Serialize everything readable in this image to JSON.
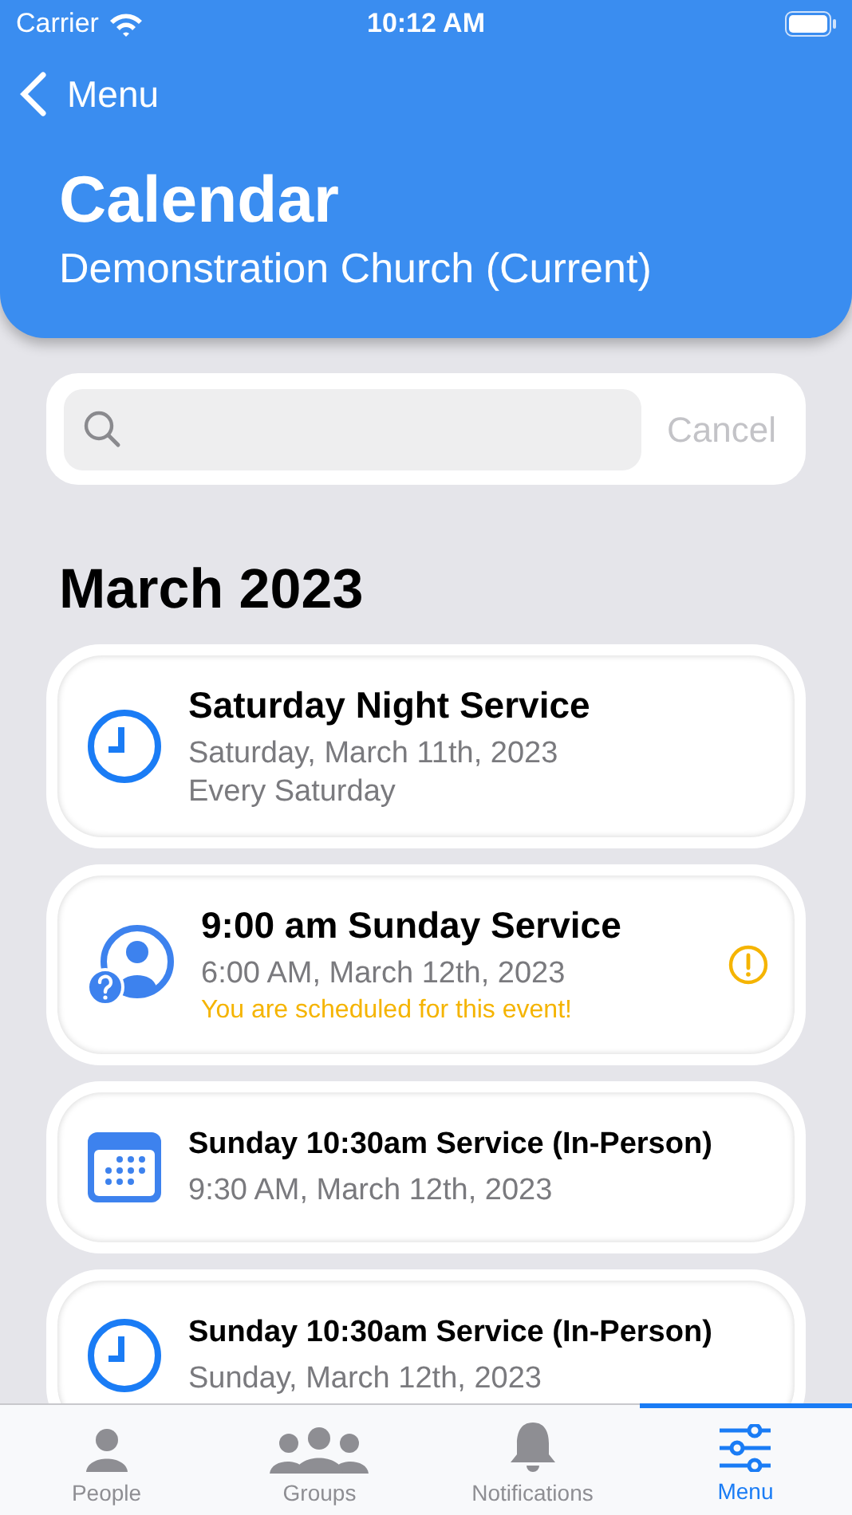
{
  "status_bar": {
    "carrier": "Carrier",
    "time": "10:12 AM"
  },
  "nav": {
    "back_label": "Menu",
    "title": "Calendar",
    "subtitle": "Demonstration Church (Current)"
  },
  "search": {
    "cancel": "Cancel"
  },
  "section": "March 2023",
  "events": [
    {
      "kind": "recurring",
      "title": "Saturday Night Service",
      "lines": [
        {
          "text": "Saturday, March 11th, 2023",
          "kind": "detail"
        },
        {
          "text": "Every Saturday",
          "kind": "detail"
        }
      ],
      "alert": false
    },
    {
      "kind": "assigned",
      "title": "9:00 am Sunday Service",
      "lines": [
        {
          "text": "6:00 AM, March 12th, 2023",
          "kind": "detail"
        },
        {
          "text": "You are scheduled for this event!",
          "kind": "alert"
        }
      ],
      "alert": true
    },
    {
      "kind": "single",
      "title": "Sunday 10:30am Service (In-Person)",
      "lines": [
        {
          "text": "9:30 AM, March 12th, 2023",
          "kind": "detail"
        }
      ],
      "alert": false
    },
    {
      "kind": "recurring",
      "title": "Sunday 10:30am Service (In-Person)",
      "lines": [
        {
          "text": "Sunday, March 12th, 2023",
          "kind": "detail"
        }
      ],
      "alert": false
    }
  ],
  "tabs": [
    {
      "label": "People",
      "selected": false
    },
    {
      "label": "Groups",
      "selected": false
    },
    {
      "label": "Notifications",
      "selected": false
    },
    {
      "label": "Menu",
      "selected": true
    }
  ]
}
